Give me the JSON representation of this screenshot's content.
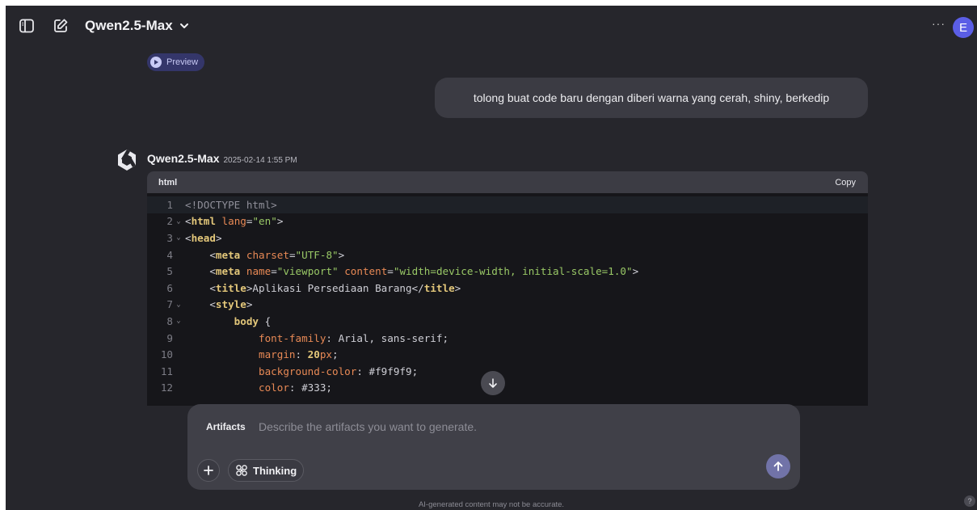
{
  "header": {
    "model_name": "Qwen2.5-Max",
    "more_label": "···",
    "avatar_initial": "E"
  },
  "preview": {
    "label": "Preview"
  },
  "user_message": {
    "text": "tolong buat code baru dengan diberi warna yang cerah, shiny, berkedip"
  },
  "assistant": {
    "name": "Qwen2.5-Max",
    "timestamp": "2025-02-14 1:55 PM"
  },
  "code_block": {
    "language": "html",
    "copy_label": "Copy",
    "lines": [
      {
        "n": "1",
        "fold": false,
        "tokens": [
          [
            "doctype",
            "<!DOCTYPE html>"
          ]
        ]
      },
      {
        "n": "2",
        "fold": true,
        "tokens": [
          [
            "punct",
            "<"
          ],
          [
            "tag",
            "html"
          ],
          [
            "punct",
            " "
          ],
          [
            "attr",
            "lang"
          ],
          [
            "punct",
            "="
          ],
          [
            "str",
            "\"en\""
          ],
          [
            "punct",
            ">"
          ]
        ]
      },
      {
        "n": "3",
        "fold": true,
        "tokens": [
          [
            "punct",
            "<"
          ],
          [
            "tag",
            "head"
          ],
          [
            "punct",
            ">"
          ]
        ]
      },
      {
        "n": "4",
        "fold": false,
        "tokens": [
          [
            "punct",
            "    <"
          ],
          [
            "tag",
            "meta"
          ],
          [
            "punct",
            " "
          ],
          [
            "attr",
            "charset"
          ],
          [
            "punct",
            "="
          ],
          [
            "str",
            "\"UTF-8\""
          ],
          [
            "punct",
            ">"
          ]
        ]
      },
      {
        "n": "5",
        "fold": false,
        "tokens": [
          [
            "punct",
            "    <"
          ],
          [
            "tag",
            "meta"
          ],
          [
            "punct",
            " "
          ],
          [
            "attr",
            "name"
          ],
          [
            "punct",
            "="
          ],
          [
            "str",
            "\"viewport\""
          ],
          [
            "punct",
            " "
          ],
          [
            "attr",
            "content"
          ],
          [
            "punct",
            "="
          ],
          [
            "str",
            "\"width=device-width, initial-scale=1.0\""
          ],
          [
            "punct",
            ">"
          ]
        ]
      },
      {
        "n": "6",
        "fold": false,
        "tokens": [
          [
            "punct",
            "    <"
          ],
          [
            "tag",
            "title"
          ],
          [
            "punct",
            ">Aplikasi Persediaan Barang</"
          ],
          [
            "tag",
            "title"
          ],
          [
            "punct",
            ">"
          ]
        ]
      },
      {
        "n": "7",
        "fold": true,
        "tokens": [
          [
            "punct",
            "    <"
          ],
          [
            "tag",
            "style"
          ],
          [
            "punct",
            ">"
          ]
        ]
      },
      {
        "n": "8",
        "fold": true,
        "tokens": [
          [
            "punct",
            "        "
          ],
          [
            "tag",
            "body"
          ],
          [
            "punct",
            " {"
          ]
        ]
      },
      {
        "n": "9",
        "fold": false,
        "tokens": [
          [
            "punct",
            "            "
          ],
          [
            "prop",
            "font-family"
          ],
          [
            "punct",
            ": Arial, sans-serif;"
          ]
        ]
      },
      {
        "n": "10",
        "fold": false,
        "tokens": [
          [
            "punct",
            "            "
          ],
          [
            "prop",
            "margin"
          ],
          [
            "punct",
            ": "
          ],
          [
            "num",
            "20"
          ],
          [
            "prop",
            "px"
          ],
          [
            "punct",
            ";"
          ]
        ]
      },
      {
        "n": "11",
        "fold": false,
        "tokens": [
          [
            "punct",
            "            "
          ],
          [
            "prop",
            "background-color"
          ],
          [
            "punct",
            ": #f9f9f9;"
          ]
        ]
      },
      {
        "n": "12",
        "fold": false,
        "tokens": [
          [
            "punct",
            "            "
          ],
          [
            "prop",
            "color"
          ],
          [
            "punct",
            ": #333;"
          ]
        ]
      }
    ]
  },
  "composer": {
    "label": "Artifacts",
    "placeholder": "Describe the artifacts you want to generate.",
    "thinking_label": "Thinking"
  },
  "footer": {
    "disclaimer": "AI-generated content may not be accurate.",
    "help_label": "?"
  }
}
